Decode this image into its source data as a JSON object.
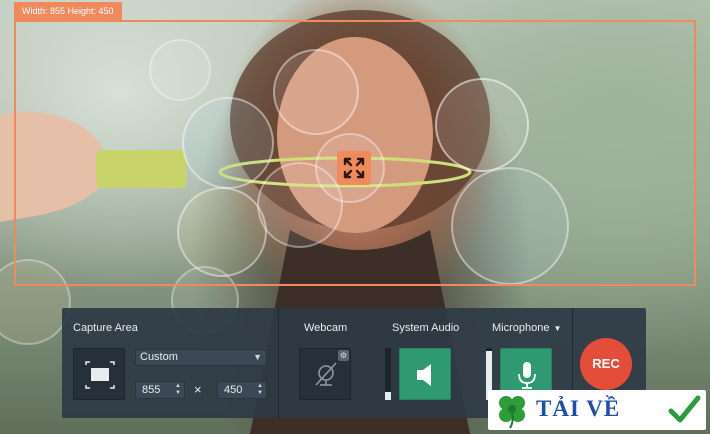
{
  "overlay": {
    "size_label": "Width: 855 Height: 450"
  },
  "toolbar": {
    "capture_area_label": "Capture Area",
    "capture_mode": "Custom",
    "width_value": "855",
    "height_value": "450",
    "times_symbol": "×",
    "webcam_label": "Webcam",
    "system_audio_label": "System Audio",
    "microphone_label": "Microphone",
    "rec_label": "REC",
    "system_audio_level": 0.15,
    "microphone_level": 0.95
  },
  "watermark": {
    "text": "TẢI VỀ"
  },
  "icons": {
    "expand": "expand-arrows-icon",
    "capture_area": "screen-area-icon",
    "webcam": "webcam-off-icon",
    "gear": "gear-icon",
    "speaker": "speaker-icon",
    "microphone": "microphone-icon",
    "clover": "clover-icon",
    "check": "checkmark-icon"
  },
  "colors": {
    "accent": "#f08a5d",
    "green": "#2f9a72",
    "rec": "#e44d3a",
    "panel": "#2f3a46"
  }
}
